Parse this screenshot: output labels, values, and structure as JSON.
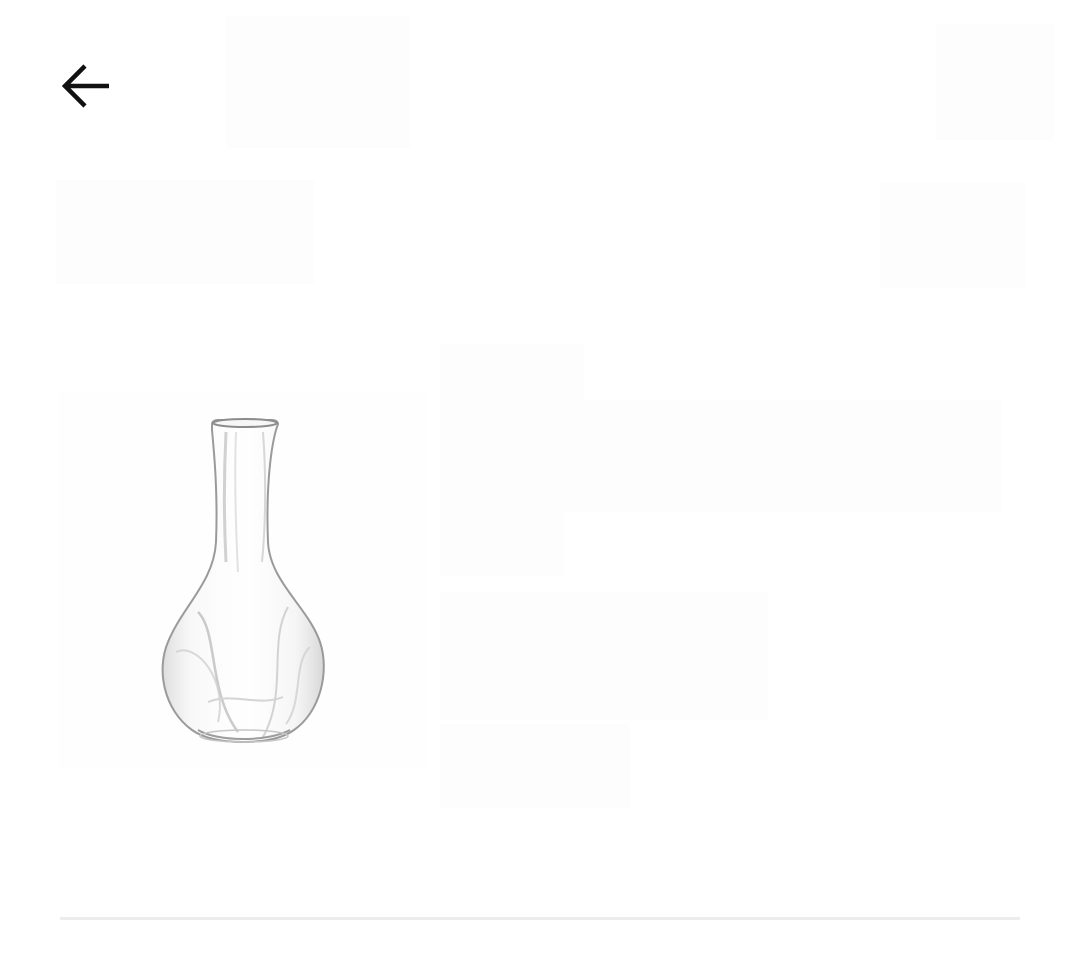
{
  "header": {
    "back_icon": "arrow-left-icon"
  },
  "product": {
    "image_icon": "glass-vase-image"
  },
  "colors": {
    "icon": "#111111",
    "divider": "#ececec",
    "background": "#ffffff"
  }
}
